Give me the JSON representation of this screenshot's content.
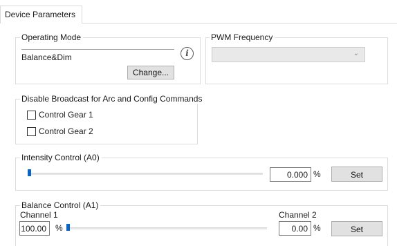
{
  "tab": {
    "label": "Device Parameters"
  },
  "operating_mode": {
    "legend": "Operating Mode",
    "value": "Balance&Dim",
    "info_icon": "info-icon",
    "change_label": "Change..."
  },
  "pwm": {
    "legend": "PWM Frequency",
    "selected": "",
    "chevron_icon": "chevron-down-icon"
  },
  "broadcast": {
    "legend": "Disable Broadcast for Arc and Config Commands",
    "items": [
      {
        "label": "Control Gear 1",
        "checked": false
      },
      {
        "label": "Control Gear 2",
        "checked": false
      }
    ]
  },
  "intensity": {
    "legend": "Intensity Control (A0)",
    "value": "0.000",
    "unit": "%",
    "slider_level": 0,
    "set_label": "Set"
  },
  "balance": {
    "legend": "Balance Control (A1)",
    "channel1_label": "Channel 1",
    "channel2_label": "Channel 2",
    "channel1_value": "100.00",
    "channel1_unit": "%",
    "channel2_value": "0.00",
    "channel2_unit": "%",
    "slider_level": 0,
    "set_label": "Set"
  },
  "colors": {
    "accent": "#0a64c8",
    "border": "#dcdcdc",
    "button_bg": "#e1e1e1"
  }
}
